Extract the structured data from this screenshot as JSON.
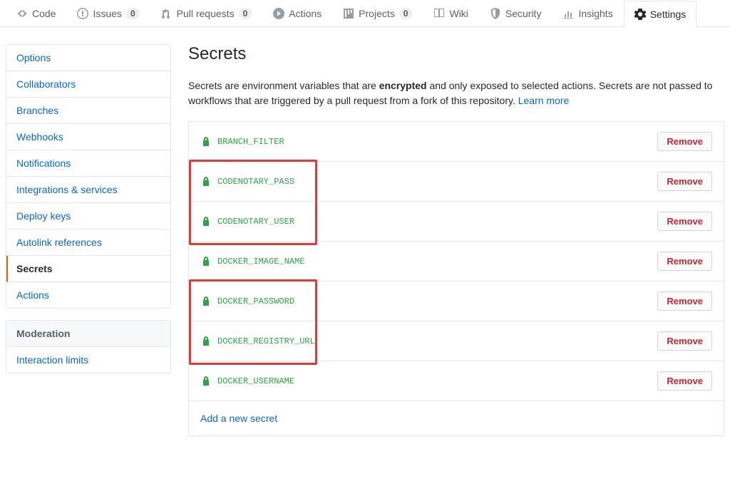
{
  "reponav": [
    {
      "icon": "code",
      "label": "Code"
    },
    {
      "icon": "issue",
      "label": "Issues",
      "count": "0"
    },
    {
      "icon": "pr",
      "label": "Pull requests",
      "count": "0"
    },
    {
      "icon": "play",
      "label": "Actions"
    },
    {
      "icon": "project",
      "label": "Projects",
      "count": "0"
    },
    {
      "icon": "book",
      "label": "Wiki"
    },
    {
      "icon": "shield",
      "label": "Security"
    },
    {
      "icon": "graph",
      "label": "Insights"
    },
    {
      "icon": "gear",
      "label": "Settings",
      "selected": true
    }
  ],
  "sidebar_primary": [
    {
      "label": "Options"
    },
    {
      "label": "Collaborators"
    },
    {
      "label": "Branches"
    },
    {
      "label": "Webhooks"
    },
    {
      "label": "Notifications"
    },
    {
      "label": "Integrations & services"
    },
    {
      "label": "Deploy keys"
    },
    {
      "label": "Autolink references"
    },
    {
      "label": "Secrets",
      "selected": true
    },
    {
      "label": "Actions"
    }
  ],
  "sidebar_mod_heading": "Moderation",
  "sidebar_mod": [
    {
      "label": "Interaction limits"
    }
  ],
  "page_title": "Secrets",
  "description_pre": "Secrets are environment variables that are ",
  "description_strong": "encrypted",
  "description_post": " and only exposed to selected actions. Secrets are not passed to workflows that are triggered by a pull request from a fork of this repository. ",
  "learn_more": "Learn more",
  "remove_label": "Remove",
  "secrets": [
    {
      "name": "BRANCH_FILTER"
    },
    {
      "name": "CODENOTARY_PASS"
    },
    {
      "name": "CODENOTARY_USER"
    },
    {
      "name": "DOCKER_IMAGE_NAME"
    },
    {
      "name": "DOCKER_PASSWORD"
    },
    {
      "name": "DOCKER_REGISTRY_URL"
    },
    {
      "name": "DOCKER_USERNAME"
    }
  ],
  "add_new_secret": "Add a new secret"
}
